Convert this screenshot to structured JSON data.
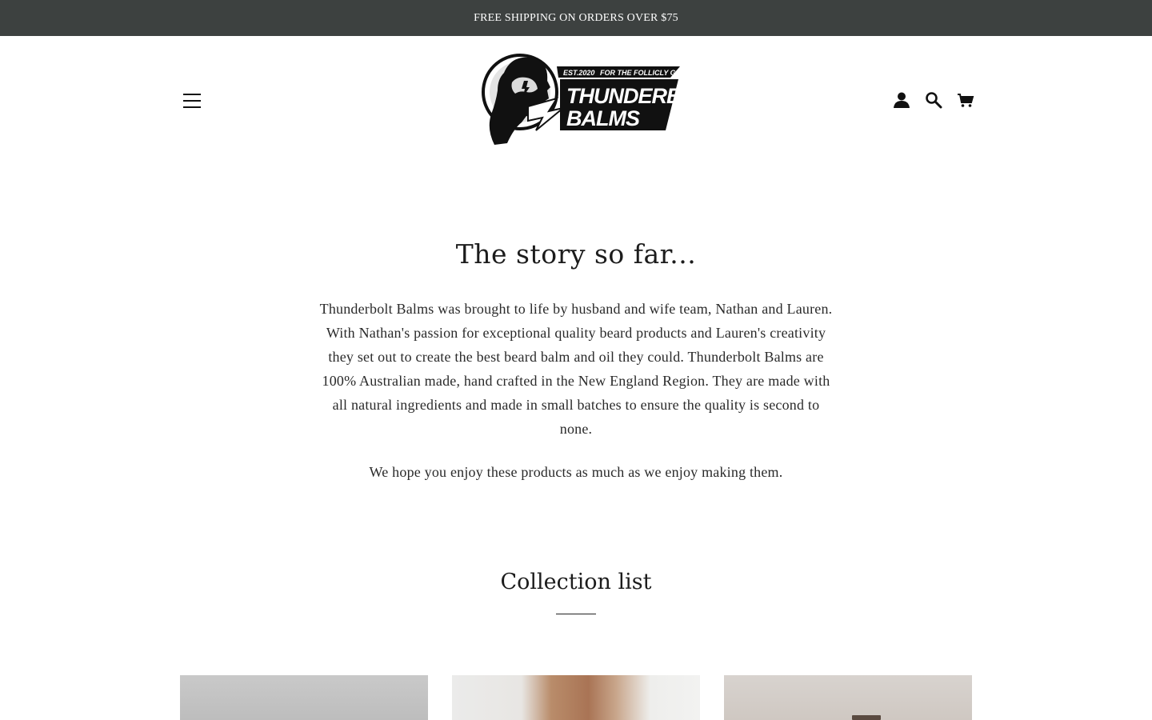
{
  "announcement": {
    "text": "FREE SHIPPING ON ORDERS OVER $75"
  },
  "header": {
    "menu_icon": "hamburger-menu-icon",
    "logo": {
      "est": "EST.2020",
      "tagline": "FOR THE FOLLICLY GIFTED.",
      "brand_line1": "THUNDERBOLT",
      "brand_line2": "BALMS"
    },
    "icons": [
      "account-icon",
      "search-icon",
      "cart-icon"
    ]
  },
  "story": {
    "title": "The story so far...",
    "paragraph1": "Thunderbolt Balms was brought to life by husband and wife team, Nathan and Lauren. With Nathan's passion for exceptional quality beard products and Lauren's creativity they set out to create the best beard balm and oil they could. Thunderbolt Balms are 100% Australian made, hand crafted in the New England Region. They are made with all natural ingredients and made in small batches to ensure the quality is second to none.",
    "paragraph2": "We hope you enjoy these products as much as we enjoy making them."
  },
  "collection": {
    "title": "Collection list",
    "cards": [
      {
        "image": "collection-image-1"
      },
      {
        "image": "collection-image-2"
      },
      {
        "image": "collection-image-3"
      }
    ]
  },
  "colors": {
    "announcement_bg": "#3d4140",
    "text": "#222222",
    "background": "#ffffff"
  }
}
